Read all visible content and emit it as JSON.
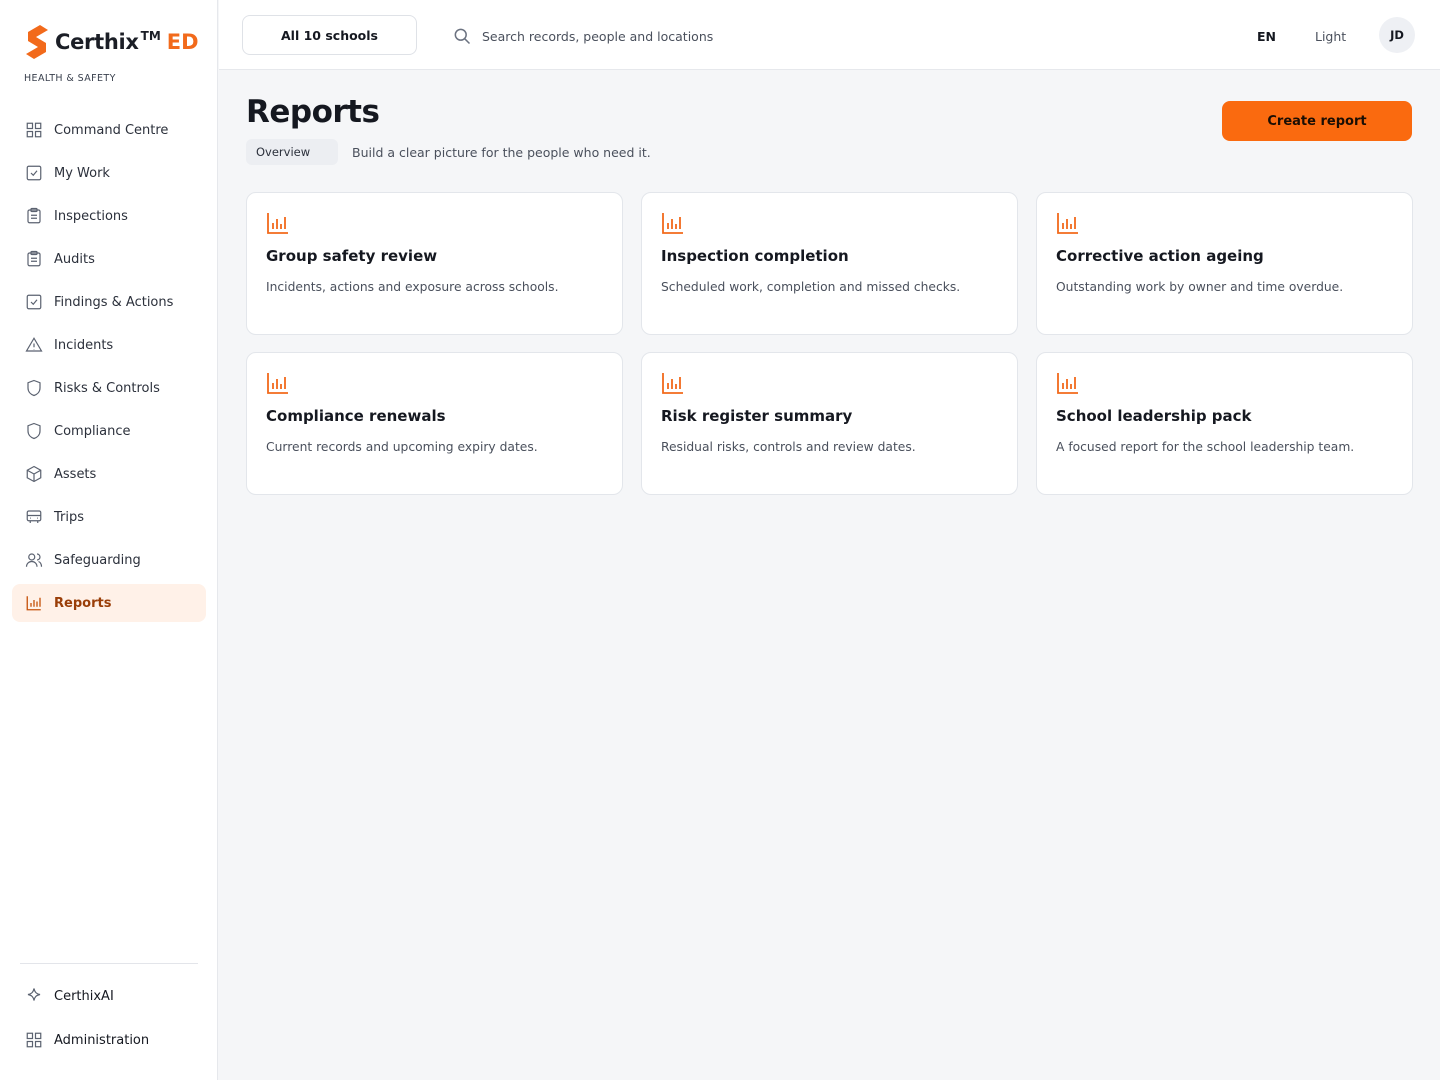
{
  "brand": {
    "name": "Certhix",
    "tm": "TM",
    "suffix": "ED",
    "tagline": "HEALTH & SAFETY",
    "accent": "#f26a1b"
  },
  "sidebar": {
    "items": [
      {
        "label": "Command Centre",
        "icon": "grid-icon"
      },
      {
        "label": "My Work",
        "icon": "checkbox-icon"
      },
      {
        "label": "Inspections",
        "icon": "clipboard-icon"
      },
      {
        "label": "Audits",
        "icon": "clipboard-icon"
      },
      {
        "label": "Findings & Actions",
        "icon": "checkbox-icon"
      },
      {
        "label": "Incidents",
        "icon": "warning-icon"
      },
      {
        "label": "Risks & Controls",
        "icon": "shield-icon"
      },
      {
        "label": "Compliance",
        "icon": "shield-icon"
      },
      {
        "label": "Assets",
        "icon": "cube-icon"
      },
      {
        "label": "Trips",
        "icon": "bus-icon"
      },
      {
        "label": "Safeguarding",
        "icon": "people-icon"
      },
      {
        "label": "Reports",
        "icon": "bar-chart-icon",
        "active": true
      }
    ],
    "bottom": [
      {
        "label": "CerthixAI",
        "icon": "sparkle-icon"
      },
      {
        "label": "Administration",
        "icon": "grid-icon"
      }
    ]
  },
  "topbar": {
    "school_picker": "All 10 schools",
    "search_placeholder": "Search records, people and locations",
    "language": "EN",
    "theme": "Light",
    "avatar_initials": "JD"
  },
  "header": {
    "title": "Reports",
    "tag": "Overview",
    "subtitle": "Build a clear picture for the people who need it.",
    "create_label": "Create report",
    "create_color": "#fa6a0f"
  },
  "cards": [
    {
      "title": "Group safety review",
      "description": "Incidents, actions and exposure across schools.",
      "icon": "bar-chart-icon"
    },
    {
      "title": "Inspection completion",
      "description": "Scheduled work, completion and missed checks.",
      "icon": "bar-chart-icon"
    },
    {
      "title": "Corrective action ageing",
      "description": "Outstanding work by owner and time overdue.",
      "icon": "bar-chart-icon"
    },
    {
      "title": "Compliance renewals",
      "description": "Current records and upcoming expiry dates.",
      "icon": "bar-chart-icon"
    },
    {
      "title": "Risk register summary",
      "description": "Residual risks, controls and review dates.",
      "icon": "bar-chart-icon"
    },
    {
      "title": "School leadership pack",
      "description": "A focused report for the school leadership team.",
      "icon": "bar-chart-icon"
    }
  ]
}
